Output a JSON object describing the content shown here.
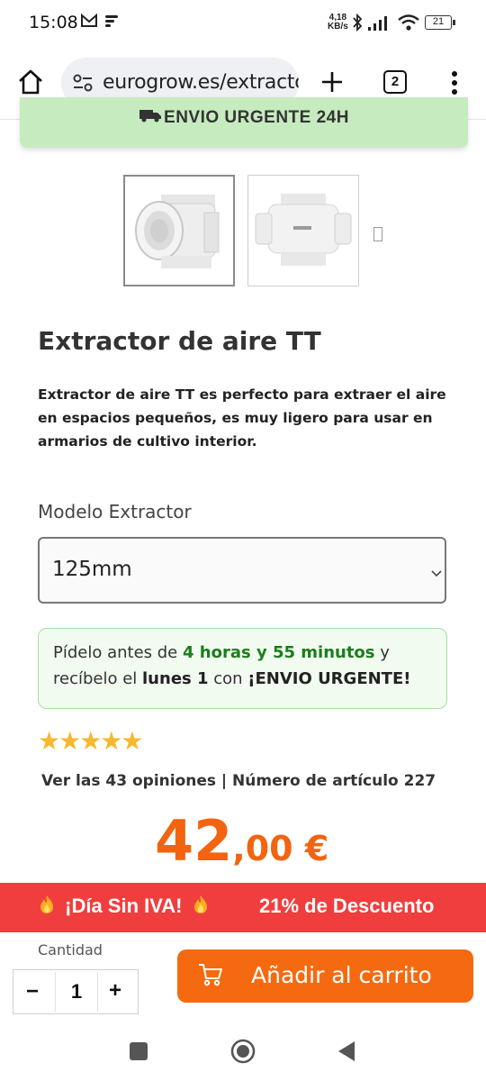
{
  "status_bar": {
    "time": "15:08",
    "net_speed": "4,18",
    "net_unit": "KB/s",
    "battery": "21"
  },
  "browser": {
    "url": "eurogrow.es/extractor",
    "tab_count": "2"
  },
  "banner": {
    "text": "ENVIO URGENTE 24H"
  },
  "product": {
    "title": "Extractor de aire TT",
    "description": "Extractor de aire TT es perfecto para extraer el aire en espacios pequeños, es muy ligero para usar en armarios de cultivo interior."
  },
  "model": {
    "label": "Modelo Extractor",
    "selected": "125mm"
  },
  "delivery": {
    "pre": "Pídelo antes de ",
    "time": "4 horas y 55 minutos",
    "post": " y",
    "line2_pre": "recíbelo el ",
    "day": "lunes 1",
    "mid": " con ",
    "urgent": "¡ENVIO URGENTE!"
  },
  "rating": {
    "stars": "★★★★★",
    "value": 5,
    "max": 5
  },
  "reviews": {
    "text": "Ver las 43 opiniones | Número de artículo 227"
  },
  "price": {
    "integer": "42",
    "decimal": ",00 €"
  },
  "promo": {
    "left": "¡Día Sin IVA!",
    "right": "21% de Descuento"
  },
  "cart": {
    "quantity_label": "Cantidad",
    "quantity": "1",
    "minus": "−",
    "plus": "+",
    "add_label": "Añadir al carrito"
  },
  "colors": {
    "accent": "#f26410",
    "promo_red": "#f03e3e",
    "banner_green": "#c6ebbf",
    "delivery_green": "#1b7d1b"
  }
}
